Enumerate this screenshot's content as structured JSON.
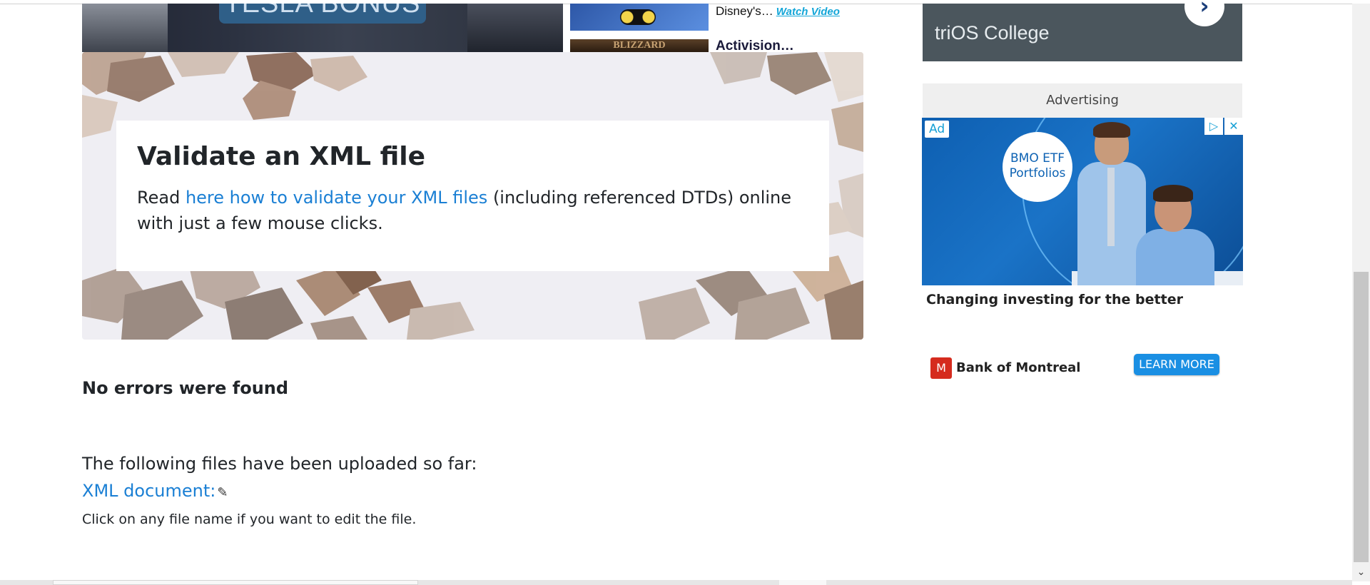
{
  "video": {
    "main_caption": "TESLA BONUS",
    "side1_text": "Disney's…",
    "side1_link": "Watch Video",
    "side2_thumb_text": "BLIZZARD",
    "side2_text": "Activision…"
  },
  "hero": {
    "title": "Validate an XML file",
    "text_before": "Read ",
    "link": "here how to validate your XML files",
    "text_after": " (including referenced DTDs) online with just a few mouse clicks."
  },
  "result": {
    "message": "No errors were found"
  },
  "uploads": {
    "heading": "The following files have been uploaded so far:",
    "file_link": "XML document:",
    "edit_icon": "pencil-icon",
    "hint": "Click on any file name if you want to edit the file."
  },
  "sidebar": {
    "trios_label": "triOS College",
    "next_glyph": "›",
    "ad_header": "Advertising",
    "ad_badge": "Ad",
    "ad_choices_glyph": "▷",
    "ad_close_glyph": "✕",
    "ad_bubble": "BMO ETF Portfolios",
    "ad_caption": "Changing investing for the better",
    "advertiser": "Bank of Montreal",
    "cta": "LEARN MORE"
  },
  "colors": {
    "link": "#1a7fd4",
    "cta": "#1a8fe3",
    "ad_blue": "#1a73c7",
    "trios_bg": "#4b565d"
  }
}
